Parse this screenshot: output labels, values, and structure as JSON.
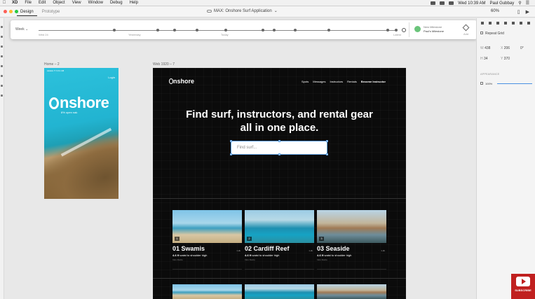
{
  "menubar": {
    "apple": "",
    "items": [
      "XD",
      "File",
      "Edit",
      "Object",
      "View",
      "Window",
      "Debug",
      "Help"
    ],
    "clock": "Wed 10:39 AM",
    "user": "Paul Gubbay"
  },
  "titlebar": {
    "tabs": [
      "Design",
      "Prototype"
    ],
    "document_title": "MAX: Onshore Surf Application",
    "zoom": "60%"
  },
  "timeline": {
    "week_label": "Week",
    "labels": [
      "Wed 24",
      "Yesterday",
      "Today",
      "Latest"
    ],
    "milestone_title": "New Milestone",
    "milestone_sub": "Paul's Milestone",
    "add_label": "Add"
  },
  "mobile_artboard": {
    "label": "Home – 2",
    "status": "●●●●● ⁕ 9:41 AM",
    "login": "Login",
    "brand": "nshore",
    "tagline": "8% open nak"
  },
  "web_artboard": {
    "label": "Web 1920 – 7",
    "brand": "nshore",
    "nav": [
      "Spots",
      "Messages",
      "Instructors",
      "Rentals",
      "Become Instructor"
    ],
    "hero_line1": "Find surf, instructors, and rental gear",
    "hero_line2": "all in one place.",
    "search_placeholder": "Find surf...",
    "cards": [
      {
        "num": "1",
        "title": "01 Swamis",
        "meta": "1.2k",
        "height": "4-6 ft",
        "height_desc": " waist to shoulder high",
        "sub": "Intro Dunlo"
      },
      {
        "num": "2",
        "title": "02 Cardiff Reef",
        "meta": "1.2k",
        "height": "4-6 ft",
        "height_desc": " waist to shoulder high",
        "sub": "Intro Dunlo"
      },
      {
        "num": "3",
        "title": "03 Seaside",
        "meta": "1.2k",
        "height": "4-6 ft",
        "height_desc": " waist to shoulder high",
        "sub": "Intro Dunlo"
      }
    ]
  },
  "panel": {
    "repeat_grid": "Repeat Grid",
    "w": "438",
    "x": "206",
    "h": "34",
    "y": "370",
    "w_label": "W",
    "x_label": "X",
    "h_label": "H",
    "y_label": "Y",
    "rotation": "0°",
    "appearance": "APPEARANCE",
    "opacity": "100%"
  },
  "subscribe": "SUBSCRIBE",
  "colors": {
    "accent": "#4a90e2",
    "milestone_green": "#6ac47a",
    "web_bg": "#0b0b0b",
    "mobile_sea": "#1aa0c4",
    "subscribe_red": "#c0201f"
  }
}
